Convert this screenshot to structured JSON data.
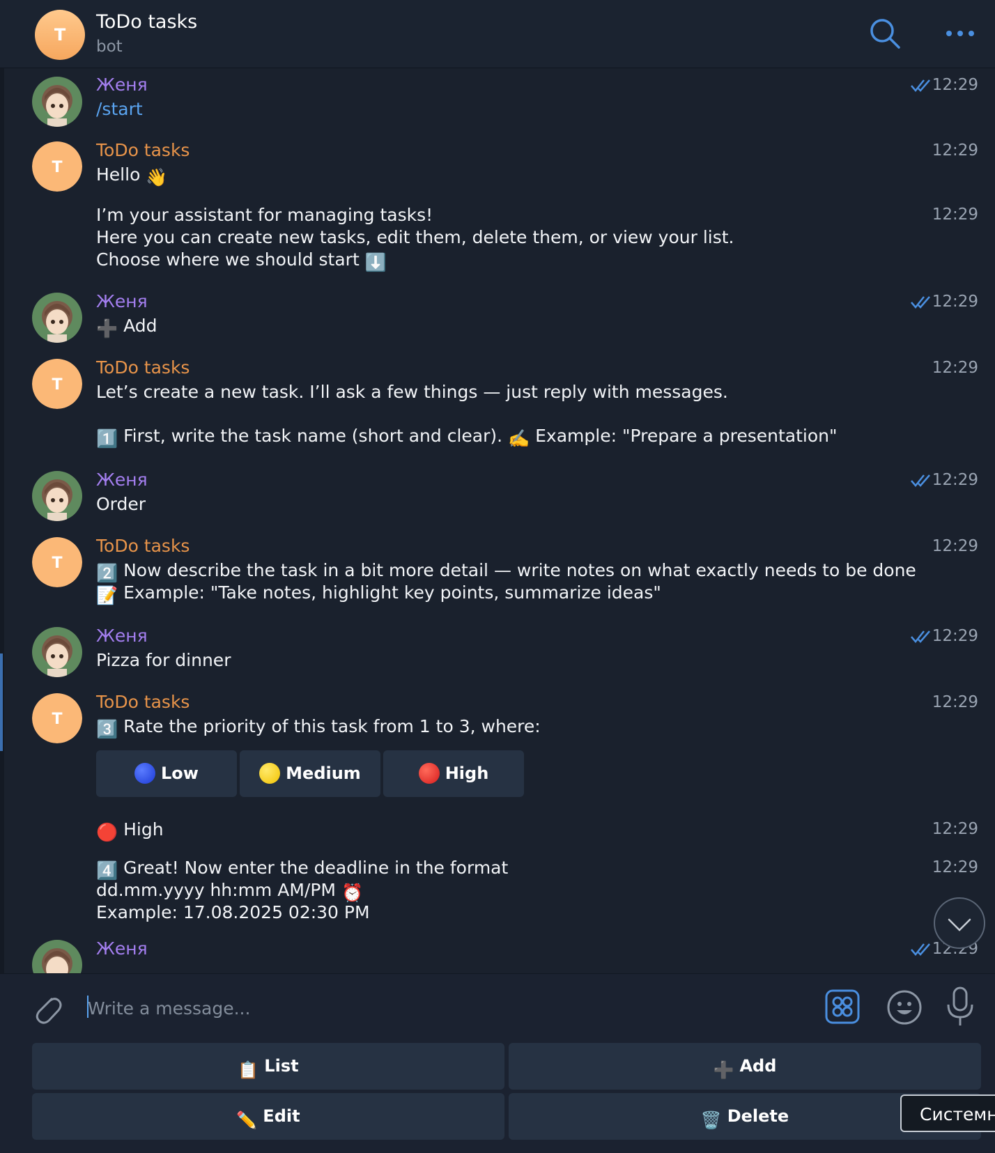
{
  "header": {
    "title": "ToDo tasks",
    "subtitle": "bot",
    "avatar_letter": "T"
  },
  "messages": {
    "m1": {
      "sender": "Женя",
      "text": "/start",
      "time": "12:29"
    },
    "m2": {
      "sender": "ToDo tasks",
      "text": "Hello",
      "time": "12:29"
    },
    "m3": {
      "line1": "I’m your assistant for managing tasks!",
      "line2": "Here you can create new tasks, edit them, delete them, or view your list.",
      "line3": "Choose where we should start",
      "time": "12:29"
    },
    "m4": {
      "sender": "Женя",
      "text": "Add",
      "time": "12:29"
    },
    "m5": {
      "sender": "ToDo tasks",
      "line1": "Let’s create a new task. I’ll ask a few things — just reply with messages.",
      "line2": "First, write the task name (short and clear).",
      "line2b": "Example: \"Prepare a presentation\"",
      "time": "12:29"
    },
    "m6": {
      "sender": "Женя",
      "text": "Order",
      "time": "12:29"
    },
    "m7": {
      "sender": "ToDo tasks",
      "line1": "Now describe the task in a bit more detail — write notes on what exactly needs to be done",
      "line2": "Example: \"Take notes, highlight key points, summarize ideas\"",
      "time": "12:29"
    },
    "m8": {
      "sender": "Женя",
      "text": "Pizza for dinner",
      "time": "12:29"
    },
    "m9": {
      "sender": "ToDo tasks",
      "text": "Rate the priority of this task from 1 to 3, where:",
      "time": "12:29"
    },
    "m10": {
      "text": "High",
      "time": "12:29"
    },
    "m11": {
      "line1": "Great! Now enter the deadline in the format",
      "line2": "dd.mm.yyyy hh:mm AM/PM",
      "line3": "Example: 17.08.2025 02:30 PM",
      "time": "12:29"
    },
    "m12": {
      "sender": "Женя",
      "time": "12:29"
    }
  },
  "inline_buttons": {
    "low": "Low",
    "medium": "Medium",
    "high": "High"
  },
  "composer": {
    "placeholder": "Write a message..."
  },
  "keyboard": {
    "list": "List",
    "add": "Add",
    "edit": "Edit",
    "delete": "Delete"
  },
  "tooltip": "Системн",
  "colors": {
    "user_name": "#a47ff0",
    "bot_name": "#e8944a",
    "link": "#5aa4f0",
    "accent": "#4a8fe0"
  },
  "icons": [
    "search-icon",
    "more-icon",
    "paperclip-icon",
    "bot-menu-icon",
    "emoji-icon",
    "microphone-icon",
    "chevron-down-icon",
    "read-check-icon"
  ]
}
